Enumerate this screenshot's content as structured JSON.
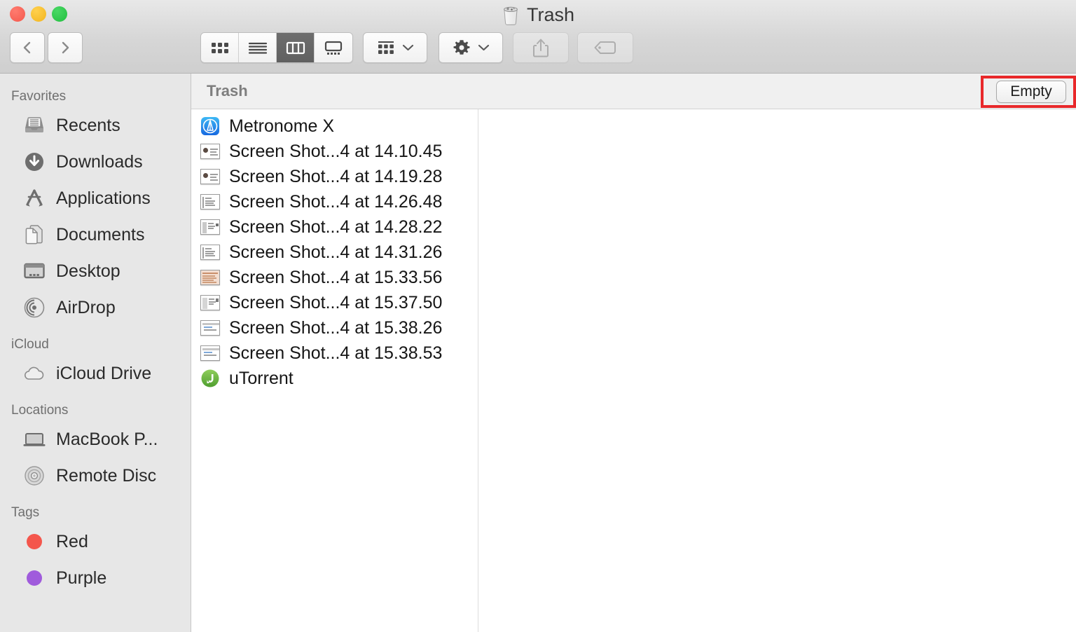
{
  "window": {
    "title": "Trash",
    "title_icon": "trash-icon",
    "traffic_lights": [
      "close",
      "minimize",
      "maximize"
    ]
  },
  "toolbar": {
    "back_label": "Back",
    "forward_label": "Forward",
    "view_modes": [
      {
        "id": "icon-view",
        "label": "Icon View",
        "active": false
      },
      {
        "id": "list-view",
        "label": "List View",
        "active": false
      },
      {
        "id": "column-view",
        "label": "Column View",
        "active": true
      },
      {
        "id": "gallery-view",
        "label": "Gallery View",
        "active": false
      }
    ],
    "arrange_label": "Arrange",
    "action_label": "Action",
    "share_label": "Share",
    "tags_label": "Tags"
  },
  "header": {
    "title": "Trash",
    "empty_button": "Empty"
  },
  "annotation": {
    "highlight_color": "#e8282a",
    "target": "empty-button"
  },
  "sidebar": {
    "sections": [
      {
        "title": "Favorites",
        "items": [
          {
            "label": "Recents",
            "icon": "recents-icon"
          },
          {
            "label": "Downloads",
            "icon": "downloads-icon"
          },
          {
            "label": "Applications",
            "icon": "applications-icon"
          },
          {
            "label": "Documents",
            "icon": "documents-icon"
          },
          {
            "label": "Desktop",
            "icon": "desktop-icon"
          },
          {
            "label": "AirDrop",
            "icon": "airdrop-icon"
          }
        ]
      },
      {
        "title": "iCloud",
        "items": [
          {
            "label": "iCloud Drive",
            "icon": "cloud-icon"
          }
        ]
      },
      {
        "title": "Locations",
        "items": [
          {
            "label": "MacBook P...",
            "icon": "laptop-icon"
          },
          {
            "label": "Remote Disc",
            "icon": "disc-icon"
          }
        ]
      },
      {
        "title": "Tags",
        "items": [
          {
            "label": "Red",
            "icon": "tag-dot",
            "color": "#f4564c"
          },
          {
            "label": "Purple",
            "icon": "tag-dot",
            "color": "#a05bdc"
          }
        ]
      }
    ]
  },
  "file_list": [
    {
      "name": "Metronome X",
      "icon": "app-metronome-icon"
    },
    {
      "name": "Screen Shot...4 at 14.10.45",
      "icon": "screenshot-thumb"
    },
    {
      "name": "Screen Shot...4 at 14.19.28",
      "icon": "screenshot-thumb"
    },
    {
      "name": "Screen Shot...4 at 14.26.48",
      "icon": "screenshot-thumb"
    },
    {
      "name": "Screen Shot...4 at 14.28.22",
      "icon": "screenshot-thumb"
    },
    {
      "name": "Screen Shot...4 at 14.31.26",
      "icon": "screenshot-thumb"
    },
    {
      "name": "Screen Shot...4 at 15.33.56",
      "icon": "screenshot-thumb"
    },
    {
      "name": "Screen Shot...4 at 15.37.50",
      "icon": "screenshot-thumb"
    },
    {
      "name": "Screen Shot...4 at 15.38.26",
      "icon": "screenshot-thumb"
    },
    {
      "name": "Screen Shot...4 at 15.38.53",
      "icon": "screenshot-thumb"
    },
    {
      "name": "uTorrent",
      "icon": "app-utorrent-icon"
    }
  ]
}
